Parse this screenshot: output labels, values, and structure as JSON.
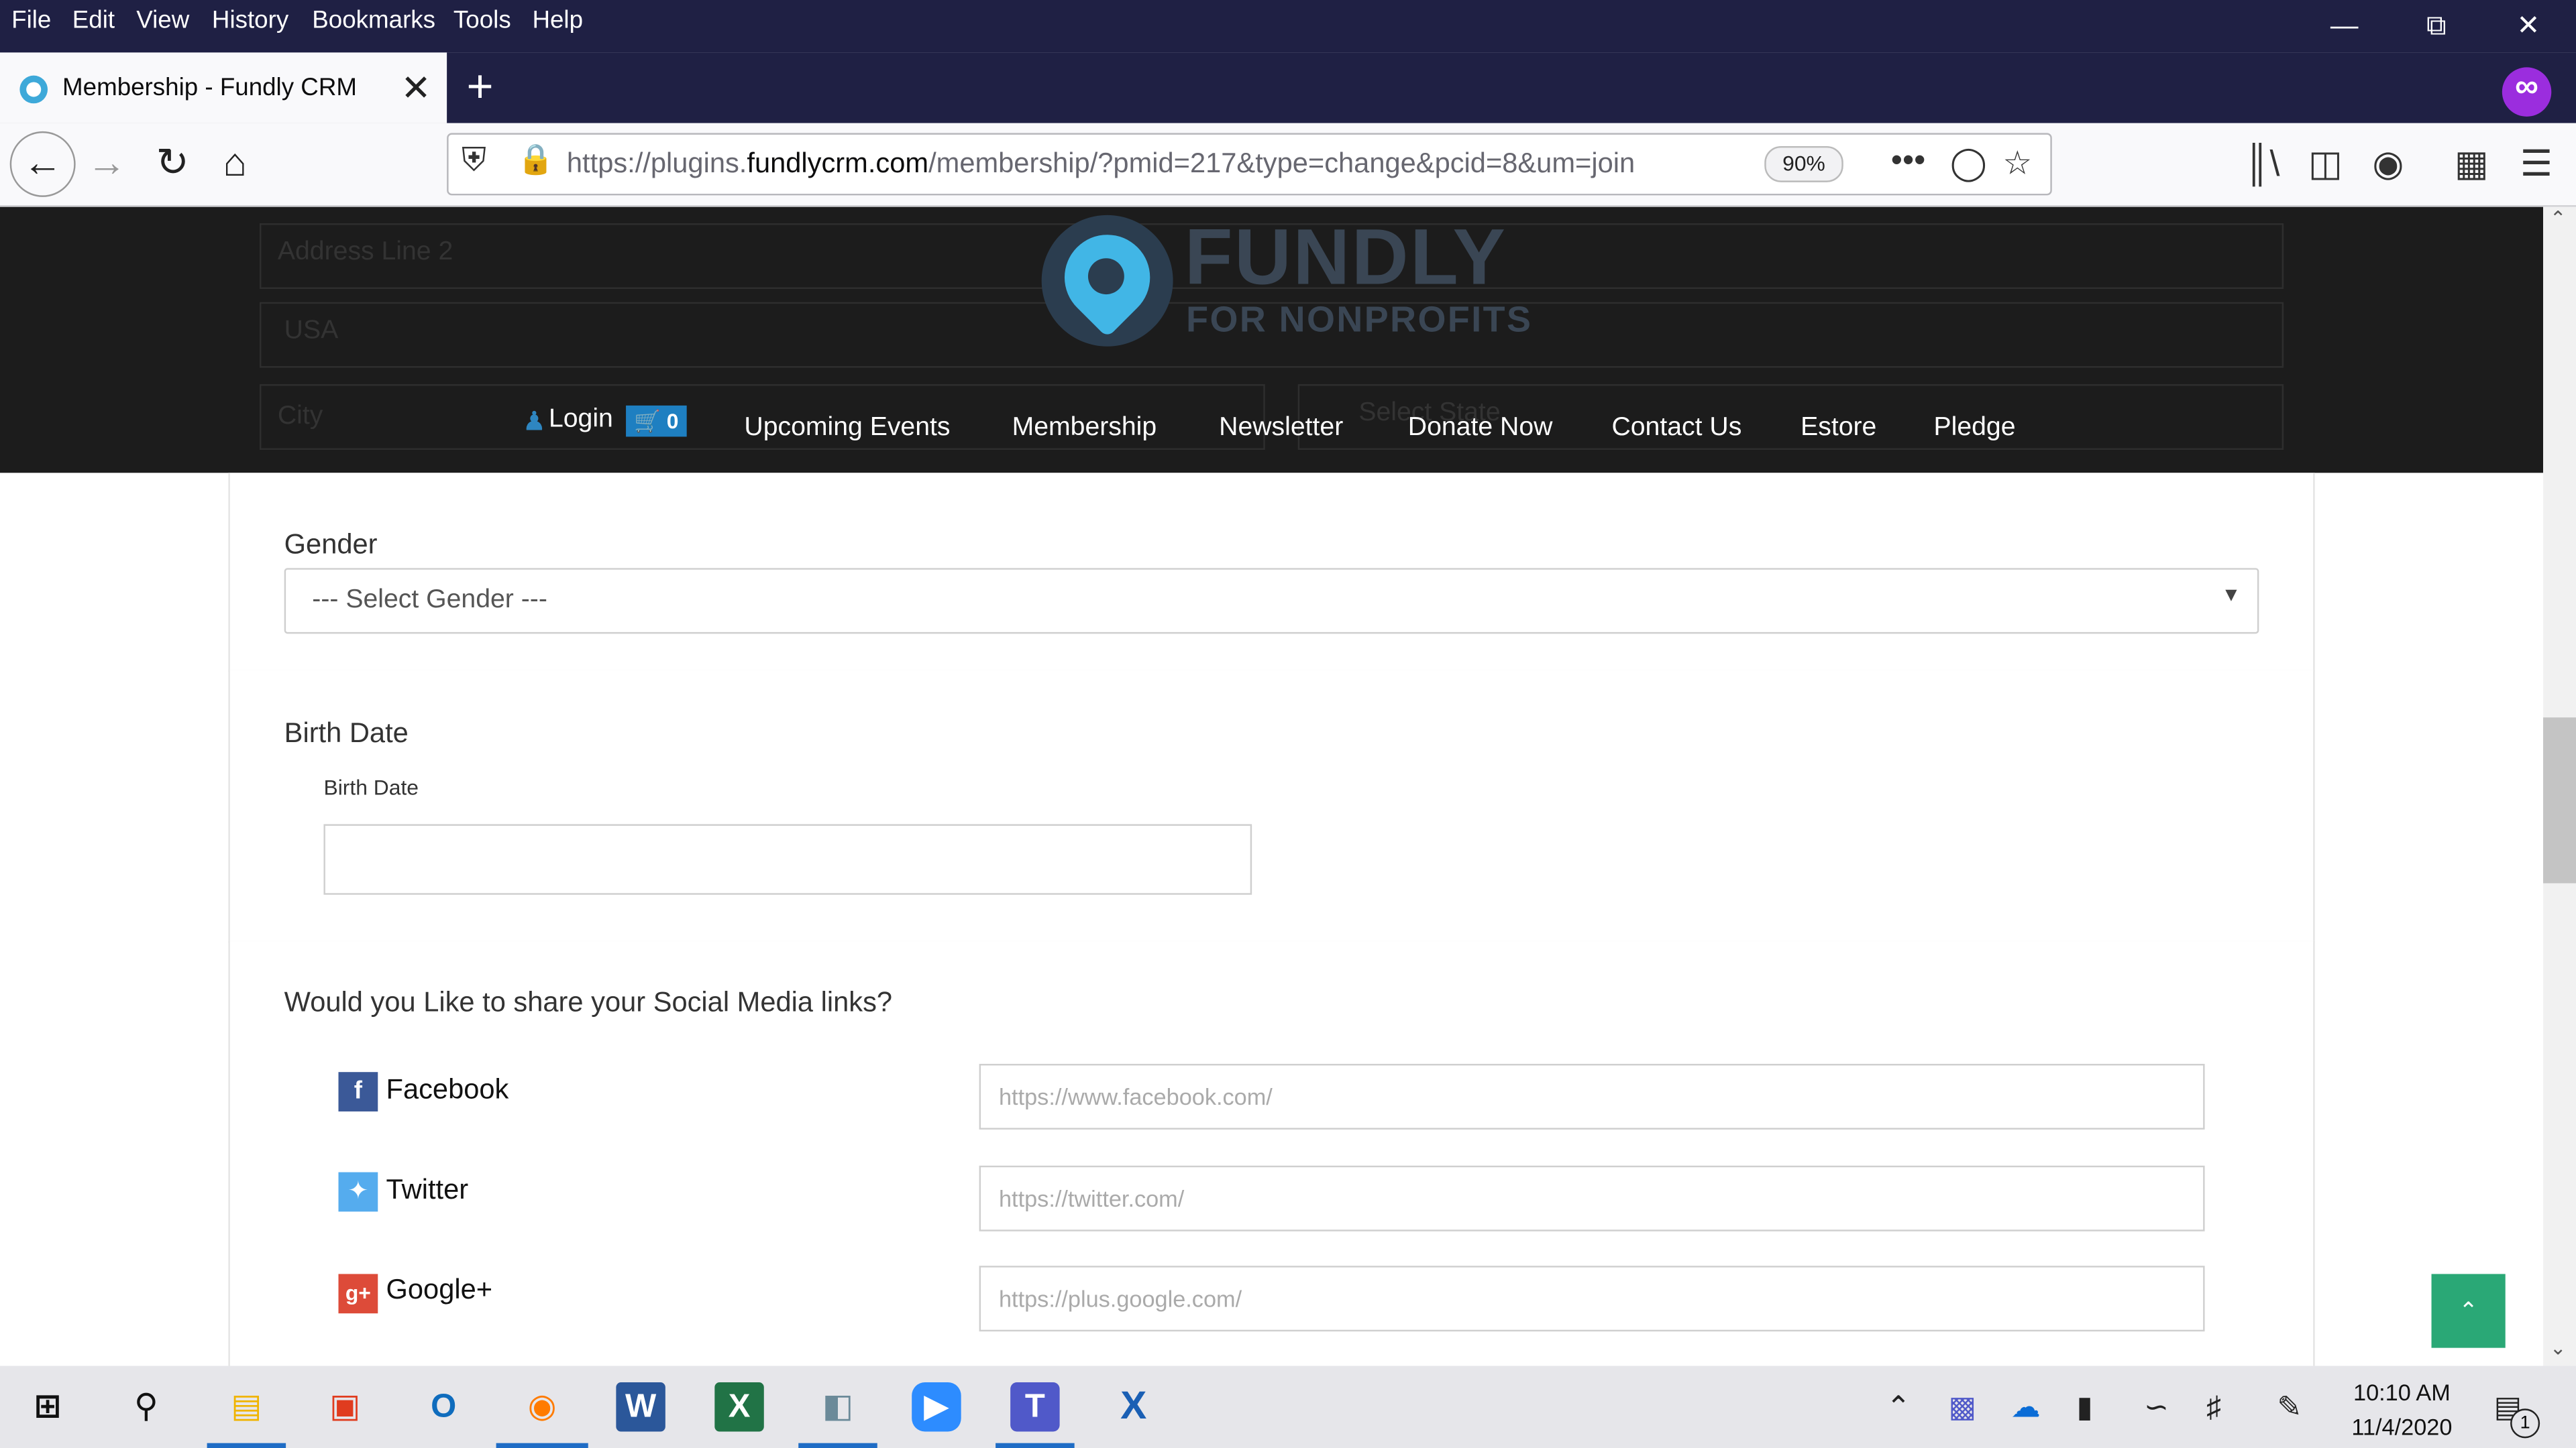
{
  "browser": {
    "menu": [
      "File",
      "Edit",
      "View",
      "History",
      "Bookmarks",
      "Tools",
      "Help"
    ],
    "tab_title": "Membership - Fundly CRM",
    "url_prefix": "https://plugins.",
    "url_domain": "fundlycrm.com",
    "url_path": "/membership/?pmid=217&type=change&pcid=8&um=join",
    "zoom": "90%"
  },
  "site": {
    "logo_main": "FUNDLY",
    "logo_sub": "FOR NONPROFITS",
    "login": "Login",
    "cart_count": "0",
    "nav": [
      "Upcoming Events",
      "Membership",
      "Newsletter",
      "Donate Now",
      "Contact Us",
      "Estore",
      "Pledge"
    ],
    "ghost_address": "Address Line 2",
    "ghost_country": "USA",
    "ghost_city": "City",
    "ghost_state": "Select State"
  },
  "form": {
    "gender_label": "Gender",
    "gender_placeholder": "--- Select Gender ---",
    "birth_label": "Birth Date",
    "birth_sublabel": "Birth Date",
    "social_question": "Would you Like to share your Social Media links?",
    "social": [
      {
        "name": "Facebook",
        "placeholder": "https://www.facebook.com/"
      },
      {
        "name": "Twitter",
        "placeholder": "https://twitter.com/"
      },
      {
        "name": "Google+",
        "placeholder": "https://plus.google.com/"
      }
    ]
  },
  "taskbar": {
    "time": "10:10 AM",
    "date": "11/4/2020",
    "notification_count": "1"
  },
  "colors": {
    "browser_dark": "#1f2044",
    "header_bg": "#1c1c1c",
    "cart_blue": "#1e7fc1",
    "back_to_top_green": "#2aa876",
    "facebook": "#3b5998",
    "twitter": "#55acee",
    "googleplus": "#dd4b39"
  }
}
